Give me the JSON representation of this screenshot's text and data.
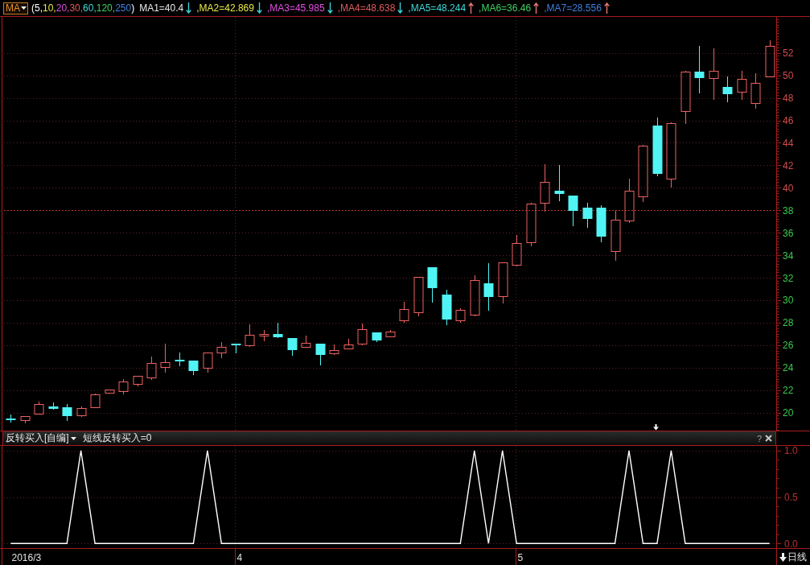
{
  "toolbar": {
    "selector": {
      "label": "MA"
    },
    "periods": [
      {
        "text": "(5,",
        "color": "#ffffff"
      },
      {
        "text": "10,",
        "color": "#e8e84a"
      },
      {
        "text": "20,",
        "color": "#e050e0"
      },
      {
        "text": "30,",
        "color": "#e05a5a"
      },
      {
        "text": "60,",
        "color": "#3fd8d8"
      },
      {
        "text": "120,",
        "color": "#40d060"
      },
      {
        "text": "250",
        "color": "#3f7fdf"
      },
      {
        "text": ")"
      }
    ],
    "ma_lines": [
      {
        "label": "MA1=40.4",
        "color": "#e8e8e8",
        "rising": false
      },
      {
        "label": ",MA2=42.869",
        "color": "#e8e84a",
        "rising": false
      },
      {
        "label": ",MA3=45.985",
        "color": "#e050e0",
        "rising": false
      },
      {
        "label": ",MA4=48.638",
        "color": "#e05a5a",
        "rising": false
      },
      {
        "label": ",MA5=48.244",
        "color": "#3fd8d8",
        "rising": true
      },
      {
        "label": ",MA6=36.46",
        "color": "#40d060",
        "rising": true
      },
      {
        "label": ",MA7=28.556",
        "color": "#3f7fdf",
        "rising": true
      }
    ]
  },
  "price_chart": {
    "chart_data": {
      "type": "candlestick",
      "grid": true,
      "ylim": [
        18.4,
        55.2
      ],
      "yticks": [
        52,
        50,
        48,
        46,
        44,
        42,
        40,
        38,
        36,
        34,
        32,
        30,
        28,
        26,
        24,
        22,
        20
      ],
      "ref_lines": [
        {
          "axis": "y",
          "value": 38.04
        }
      ],
      "ohlc": [
        [
          19.5,
          19.86,
          19.21,
          19.36
        ],
        [
          19.36,
          19.71,
          19.14,
          19.71
        ],
        [
          19.93,
          21.0,
          19.93,
          20.79
        ],
        [
          20.57,
          20.93,
          20.36,
          20.36
        ],
        [
          20.5,
          20.79,
          19.36,
          19.71
        ],
        [
          19.79,
          20.57,
          19.71,
          20.43
        ],
        [
          20.5,
          21.72,
          20.5,
          21.65
        ],
        [
          21.79,
          22.08,
          21.79,
          22.08
        ],
        [
          21.93,
          23.01,
          21.72,
          22.79
        ],
        [
          22.58,
          23.29,
          22.43,
          23.29
        ],
        [
          23.15,
          25.01,
          23.01,
          24.44
        ],
        [
          24.08,
          26.16,
          23.65,
          24.51
        ],
        [
          24.72,
          25.37,
          24.22,
          24.58
        ],
        [
          24.65,
          24.65,
          23.44,
          23.72
        ],
        [
          24.01,
          25.37,
          23.65,
          25.37
        ],
        [
          25.37,
          26.3,
          24.94,
          25.87
        ],
        [
          26.16,
          26.16,
          25.37,
          26.01
        ],
        [
          26.01,
          27.87,
          25.94,
          26.94
        ],
        [
          26.87,
          27.37,
          26.44,
          27.01
        ],
        [
          27.01,
          28.02,
          26.73,
          26.73
        ],
        [
          26.66,
          26.66,
          25.15,
          25.58
        ],
        [
          25.87,
          26.87,
          25.87,
          26.23
        ],
        [
          26.16,
          26.16,
          24.29,
          25.15
        ],
        [
          25.3,
          26.08,
          25.23,
          25.58
        ],
        [
          25.73,
          26.59,
          25.73,
          26.08
        ],
        [
          26.16,
          27.95,
          26.08,
          27.44
        ],
        [
          27.16,
          27.16,
          26.37,
          26.44
        ],
        [
          26.8,
          27.37,
          26.8,
          27.23
        ],
        [
          28.23,
          29.88,
          28.09,
          29.23
        ],
        [
          28.95,
          32.1,
          28.66,
          32.1
        ],
        [
          32.96,
          32.96,
          29.88,
          31.1
        ],
        [
          30.52,
          30.95,
          27.87,
          28.3
        ],
        [
          28.23,
          29.31,
          28.09,
          29.16
        ],
        [
          28.73,
          32.24,
          28.66,
          31.81
        ],
        [
          31.52,
          33.31,
          29.16,
          30.31
        ],
        [
          30.38,
          33.39,
          29.81,
          33.39
        ],
        [
          33.17,
          35.82,
          33.1,
          35.1
        ],
        [
          35.18,
          38.68,
          34.89,
          38.61
        ],
        [
          38.68,
          42.12,
          37.97,
          40.54
        ],
        [
          39.76,
          42.05,
          38.9,
          39.47
        ],
        [
          39.33,
          39.33,
          36.68,
          37.97
        ],
        [
          38.25,
          38.68,
          36.54,
          37.25
        ],
        [
          38.25,
          38.47,
          35.25,
          35.68
        ],
        [
          34.39,
          37.97,
          33.6,
          37.18
        ],
        [
          37.11,
          40.83,
          36.96,
          39.76
        ],
        [
          39.26,
          43.84,
          38.83,
          43.77
        ],
        [
          45.55,
          46.27,
          41.12,
          41.26
        ],
        [
          40.83,
          45.84,
          40.11,
          45.77
        ],
        [
          46.84,
          50.42,
          45.77,
          50.35
        ],
        [
          50.35,
          52.64,
          48.49,
          49.78
        ],
        [
          49.78,
          52.43,
          47.92,
          50.42
        ],
        [
          48.99,
          49.92,
          47.71,
          48.35
        ],
        [
          48.56,
          50.42,
          47.92,
          49.71
        ],
        [
          47.56,
          50.21,
          47.14,
          49.35
        ],
        [
          49.92,
          53.14,
          49.92,
          52.64
        ]
      ]
    }
  },
  "indicator": {
    "selector": {
      "label": "反转买入[自编]"
    },
    "reading": "短线反转买入=0",
    "help": "?",
    "chart_data": {
      "type": "line",
      "grid": true,
      "ylim": [
        -0.05,
        1.05
      ],
      "yticks": [
        {
          "value": 1,
          "label": "1.0"
        },
        {
          "value": 0.5,
          "label": "0.5"
        },
        {
          "value": 0,
          "label": "0.0"
        }
      ],
      "series": [
        {
          "color": "#ffffff",
          "values": [
            0,
            0,
            0,
            0,
            0,
            1,
            0,
            0,
            0,
            0,
            0,
            0,
            0,
            0,
            1,
            0,
            0,
            0,
            0,
            0,
            0,
            0,
            0,
            0,
            0,
            0,
            0,
            0,
            0,
            0,
            0,
            0,
            0,
            1,
            0,
            1,
            0,
            0,
            0,
            0,
            0,
            0,
            0,
            0,
            1,
            0,
            0,
            1,
            0,
            0,
            0,
            0,
            0,
            0,
            0
          ]
        }
      ]
    }
  },
  "date_labels": [
    "2016/3",
    "4",
    "5"
  ],
  "period_button": {
    "label": "日线"
  }
}
